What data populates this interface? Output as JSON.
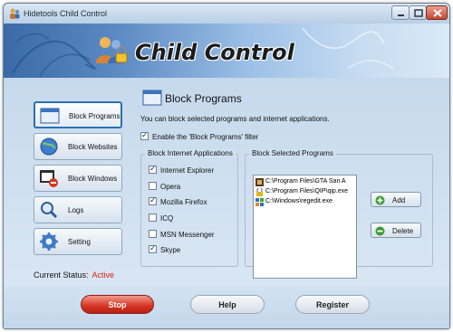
{
  "window": {
    "title": "Hidetools Child Control",
    "controls": [
      "minimize-icon",
      "maximize-icon",
      "close-icon"
    ]
  },
  "banner": {
    "title": "Child Control"
  },
  "sidebar": {
    "items": [
      {
        "label": "Block Programs",
        "icon": "window-icon",
        "active": true
      },
      {
        "label": "Block Websites",
        "icon": "globe-icon",
        "active": false
      },
      {
        "label": "Block Windows",
        "icon": "window-block-icon",
        "active": false
      },
      {
        "label": "Logs",
        "icon": "magnifier-icon",
        "active": false
      },
      {
        "label": "Setting",
        "icon": "gear-icon",
        "active": false
      }
    ]
  },
  "status": {
    "label": "Current Status:",
    "value": "Active"
  },
  "panel": {
    "title": "Block Programs",
    "description": "You can block selected programs and internet applications.",
    "enable_filter": {
      "label": "Enable the 'Block Programs' filter",
      "checked": true
    },
    "internet_apps": {
      "title": "Block Internet Applications",
      "items": [
        {
          "label": "Internet Explorer",
          "checked": true
        },
        {
          "label": "Opera",
          "checked": false
        },
        {
          "label": "Mozilla Firefox",
          "checked": true
        },
        {
          "label": "ICQ",
          "checked": false
        },
        {
          "label": "MSN Messenger",
          "checked": false
        },
        {
          "label": "Skype",
          "checked": true
        }
      ]
    },
    "selected_programs": {
      "title": "Block Selected Programs",
      "items": [
        {
          "path": "C:\\Program Files\\GTA San A",
          "icon": "game-icon"
        },
        {
          "path": "C:\\Program Files\\QIP\\qip.exe",
          "icon": "qip-icon"
        },
        {
          "path": "C:\\Windows\\regedit.exe",
          "icon": "regedit-icon"
        }
      ],
      "add_label": "Add",
      "delete_label": "Delete"
    }
  },
  "footer": {
    "stop_label": "Stop",
    "help_label": "Help",
    "register_label": "Register"
  },
  "colors": {
    "status_active": "#e31b12",
    "stop_button": "#d43322",
    "accent": "#2b6fb2"
  }
}
